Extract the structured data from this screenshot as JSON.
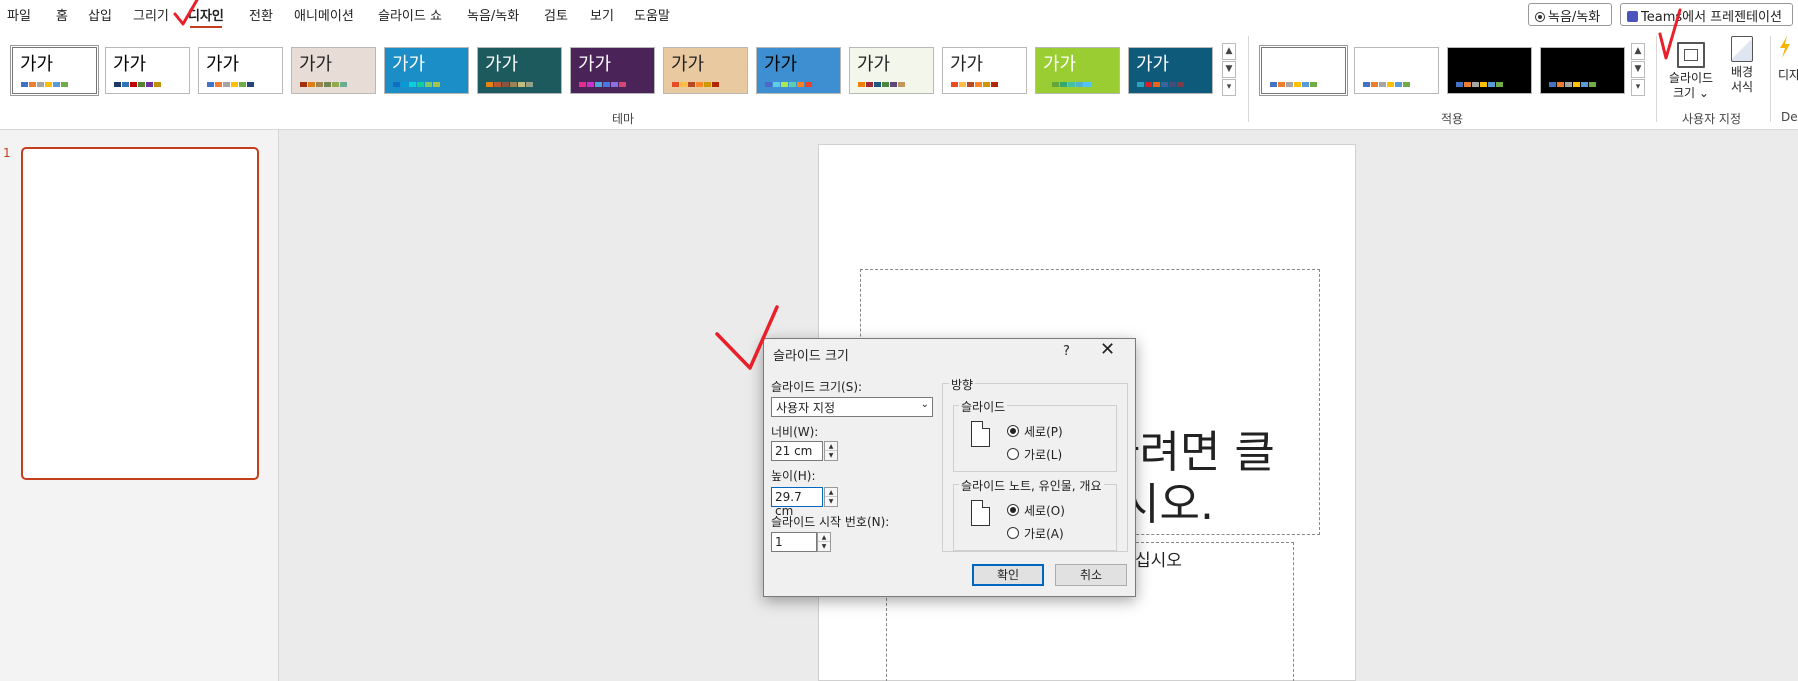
{
  "menu": {
    "tabs": [
      "파일",
      "홈",
      "삽입",
      "그리기",
      "디자인",
      "전환",
      "애니메이션",
      "슬라이드 쇼",
      "녹음/녹화",
      "검토",
      "보기",
      "도움말"
    ],
    "active_tab": "디자인",
    "record_button": "녹음/녹화",
    "teams_button": "Teams에서 프레젠테이션"
  },
  "ribbon": {
    "theme_thumb_label": "가가",
    "themes_group_label": "테마",
    "variants_group_label": "적용",
    "customize_group_label": "사용자 지정",
    "slide_size_label_line1": "슬라이드",
    "slide_size_label_line2": "크기",
    "format_bg_label_line1": "배경",
    "format_bg_label_line2": "서식",
    "designer_label": "디자",
    "designer_group_label": "De",
    "theme_colors": [
      {
        "bg": "#ffffff",
        "fg": "#000000",
        "sw": [
          "#4472c4",
          "#ed7d31",
          "#a5a5a5",
          "#ffc000",
          "#5b9bd5",
          "#70ad47"
        ]
      },
      {
        "bg": "#ffffff",
        "fg": "#000000",
        "sw": [
          "#1f3864",
          "#2e75b6",
          "#c00000",
          "#548235",
          "#7030a0",
          "#bf9000"
        ]
      },
      {
        "bg": "#ffffff",
        "fg": "#000000",
        "sw": [
          "#4472c4",
          "#ed7d31",
          "#a5a5a5",
          "#ffc000",
          "#70ad47",
          "#264478"
        ]
      },
      {
        "bg": "#e8dcd6",
        "fg": "#222222",
        "sw": [
          "#a53010",
          "#de7e18",
          "#9f8351",
          "#728653",
          "#92aa4c",
          "#6aac91"
        ]
      },
      {
        "bg": "#1b8ec7",
        "fg": "#ffffff",
        "sw": [
          "#0f6fc6",
          "#009dd9",
          "#0bd0d9",
          "#10cf9b",
          "#7cca62",
          "#a5c249"
        ]
      },
      {
        "bg": "#1d5a5e",
        "fg": "#ffffff",
        "sw": [
          "#e48312",
          "#bd582c",
          "#865640",
          "#9b8357",
          "#c2bc80",
          "#94a088"
        ]
      },
      {
        "bg": "#4a2358",
        "fg": "#ffffff",
        "sw": [
          "#e32d91",
          "#c830cc",
          "#4ea6dc",
          "#4775e7",
          "#8971e1",
          "#d54773"
        ]
      },
      {
        "bg": "#e8c9a0",
        "fg": "#222222",
        "sw": [
          "#e84c22",
          "#ffbd47",
          "#b64926",
          "#ff8427",
          "#cc9900",
          "#b22600"
        ]
      },
      {
        "bg": "#3d8fd1",
        "fg": "#000000",
        "sw": [
          "#4e67c8",
          "#5ecce6",
          "#a7ea52",
          "#5dceaf",
          "#ff8021",
          "#f14124"
        ]
      },
      {
        "bg": "#f3f6ea",
        "fg": "#222222",
        "sw": [
          "#f07f09",
          "#9f2936",
          "#1b587c",
          "#4e8542",
          "#604878",
          "#c19859"
        ]
      },
      {
        "bg": "#ffffff",
        "fg": "#222222",
        "sw": [
          "#e84c22",
          "#ffbd47",
          "#b64926",
          "#ff8427",
          "#cc9900",
          "#b22600"
        ]
      },
      {
        "bg": "#9acd32",
        "fg": "#ffffff",
        "sw": [
          "#99cb38",
          "#63a537",
          "#37a76f",
          "#44c1a3",
          "#4eb3cf",
          "#51c3f9"
        ]
      },
      {
        "bg": "#0e5a7a",
        "fg": "#ffffff",
        "sw": [
          "#2da2bf",
          "#da1f28",
          "#eb641b",
          "#39639d",
          "#474b78",
          "#7d3c4a"
        ]
      }
    ],
    "variant_colors": [
      {
        "bg": "#ffffff",
        "sw": [
          "#4472c4",
          "#ed7d31",
          "#a5a5a5",
          "#ffc000",
          "#5b9bd5",
          "#70ad47"
        ]
      },
      {
        "bg": "#ffffff",
        "sw": [
          "#4472c4",
          "#ed7d31",
          "#a5a5a5",
          "#ffc000",
          "#5b9bd5",
          "#70ad47"
        ]
      },
      {
        "bg": "#000000",
        "sw": [
          "#4472c4",
          "#ed7d31",
          "#a5a5a5",
          "#ffc000",
          "#5b9bd5",
          "#70ad47"
        ]
      },
      {
        "bg": "#000000",
        "sw": [
          "#4472c4",
          "#ed7d31",
          "#a5a5a5",
          "#ffc000",
          "#5b9bd5",
          "#70ad47"
        ]
      }
    ]
  },
  "slides_panel": {
    "slide_number": "1"
  },
  "slide": {
    "title_text_line1": "하려면 클",
    "title_text_line2": "시오.",
    "subtitle_text": "십시오"
  },
  "dialog": {
    "title": "슬라이드 크기",
    "help": "?",
    "close": "✕",
    "size_label": "슬라이드 크기(S):",
    "size_value": "사용자 지정",
    "width_label": "너비(W):",
    "width_value": "21 cm",
    "height_label": "높이(H):",
    "height_value": "29.7 cm",
    "start_label": "슬라이드 시작 번호(N):",
    "start_value": "1",
    "orientation_label": "방향",
    "slides_group_label": "슬라이드",
    "slides_portrait": "세로(P)",
    "slides_landscape": "가로(L)",
    "notes_group_label": "슬라이드 노트, 유인물, 개요",
    "notes_portrait": "세로(O)",
    "notes_landscape": "가로(A)",
    "ok": "확인",
    "cancel": "취소"
  },
  "annotation_color": "#e8202a"
}
